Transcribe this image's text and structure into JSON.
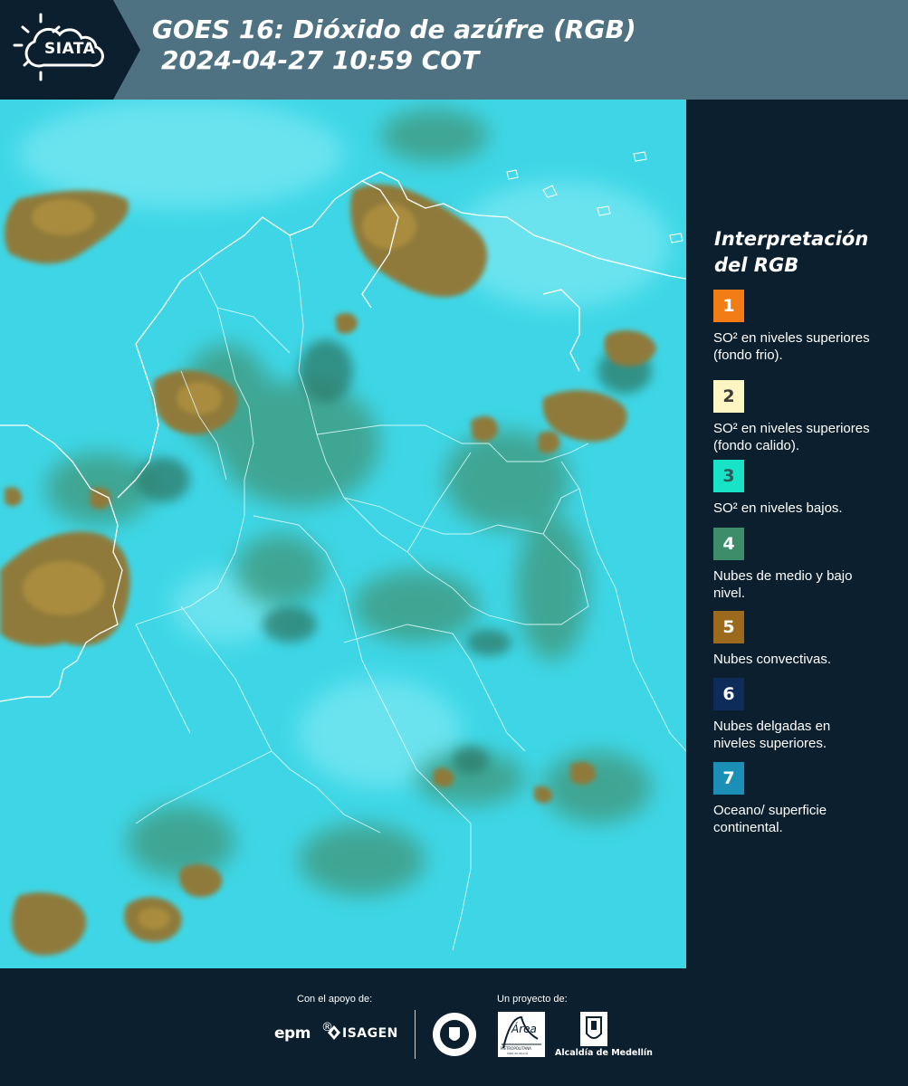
{
  "header": {
    "logo_text": "SIATA",
    "title_line1": "GOES 16: Dióxido de azúfre (RGB)",
    "title_line2": "2024-04-27 10:59 COT"
  },
  "legend": {
    "title": "Interpretación del RGB",
    "items": [
      {
        "number": "1",
        "color": "#f47c16",
        "number_color": "#ffffff",
        "text": "SO² en niveles superiores (fondo frio)."
      },
      {
        "number": "2",
        "color": "#fdf6c3",
        "number_color": "#3a3a3a",
        "text": "SO² en niveles superiores (fondo calido)."
      },
      {
        "number": "3",
        "color": "#19e3c6",
        "number_color": "#2c5a5a",
        "text": "SO² en niveles bajos."
      },
      {
        "number": "4",
        "color": "#3d8c6a",
        "number_color": "#ffffff",
        "text": "Nubes de medio y bajo nivel."
      },
      {
        "number": "5",
        "color": "#9c6a1c",
        "number_color": "#ffffff",
        "text": "Nubes convectivas."
      },
      {
        "number": "6",
        "color": "#0e2c59",
        "number_color": "#ffffff",
        "text": "Nubes delgadas en niveles superiores."
      },
      {
        "number": "7",
        "color": "#1b8fb6",
        "number_color": "#ffffff",
        "text": "Oceano/ superficie continental."
      }
    ]
  },
  "footer": {
    "support_label": "Con el apoyo de:",
    "project_label": "Un proyecto de:",
    "sponsor_epm": "epm",
    "sponsor_isagen": "ISAGEN",
    "partner_metropolitana": "METROPOLITANA",
    "partner_valle": "Valle de Aburrá",
    "partner_alcaldia": "Alcaldía de Medellín",
    "partner_area": "Área"
  },
  "colors": {
    "header_bg": "#4f7283",
    "panel_bg": "#0b1f2e",
    "map_base": "#3ed6e6"
  }
}
